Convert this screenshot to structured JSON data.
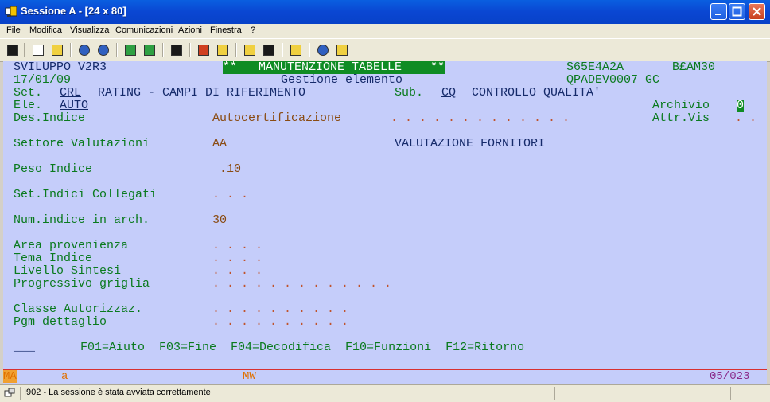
{
  "window": {
    "title": "Sessione A - [24 x 80]"
  },
  "menu": [
    "File",
    "Modifica",
    "Visualizza",
    "Comunicazioni",
    "Azioni",
    "Finestra",
    "?"
  ],
  "terminal": {
    "r1_left": "SVILUPPO V2R3",
    "r1_banner": "**   MANUTENZIONE TABELLE    **",
    "r1_code": "S65E4A2A",
    "r1_user": "B£AM30",
    "r2_date": "17/01/09",
    "r2_title": "Gestione elemento",
    "r2_right": "QPADEV0007 GC",
    "r3_set": "Set.",
    "r3_set_code": "CRL",
    "r3_set_desc": "RATING - CAMPI DI RIFERIMENTO",
    "r3_sub": "Sub.",
    "r3_sub_code": "CQ",
    "r3_sub_desc": "CONTROLLO QUALITA'",
    "r4_ele": "Ele.",
    "r4_ele_code": "AUTO",
    "r4_arch_label": "Archivio",
    "r4_arch_value": "0",
    "r5_des_label": "Des.Indice",
    "r5_des_value": "Autocertificazione",
    "r5_des_dots": " . . . . . . . . . . . . .",
    "r5_attr_label": "Attr.Vis",
    "r5_attr_dots": ". .",
    "settore_label": "Settore Valutazioni",
    "settore_value": "AA",
    "settore_desc": "VALUTAZIONE FORNITORI",
    "peso_label": "Peso Indice",
    "peso_value": " .10",
    "setind_label": "Set.Indici Collegati",
    "setind_dots": ". . .",
    "numind_label": "Num.indice in arch.",
    "numind_value": "30",
    "area_label": "Area provenienza",
    "area_dots": ". . . .",
    "tema_label": "Tema Indice",
    "tema_dots": ". . . .",
    "livello_label": "Livello Sintesi",
    "livello_dots": ". . . .",
    "progr_label": "Progressivo griglia",
    "progr_dots": ". . . . . . . . . . . . .",
    "classe_label": "Classe Autorizzaz.",
    "classe_dots": ". . . . . . . . . .",
    "pgm_label": "Pgm dettaglio",
    "pgm_dots": ". . . . . . . . . .",
    "cmd_field": "___",
    "fkeys": "F01=Aiuto  F03=Fine  F04=Decodifica  F10=Funzioni  F12=Ritorno"
  },
  "oia": {
    "ma": "MA",
    "a": "a",
    "mw": "MW",
    "pos": "05/023"
  },
  "status": {
    "message": "I902 - La sessione è stata avviata correttamente"
  }
}
